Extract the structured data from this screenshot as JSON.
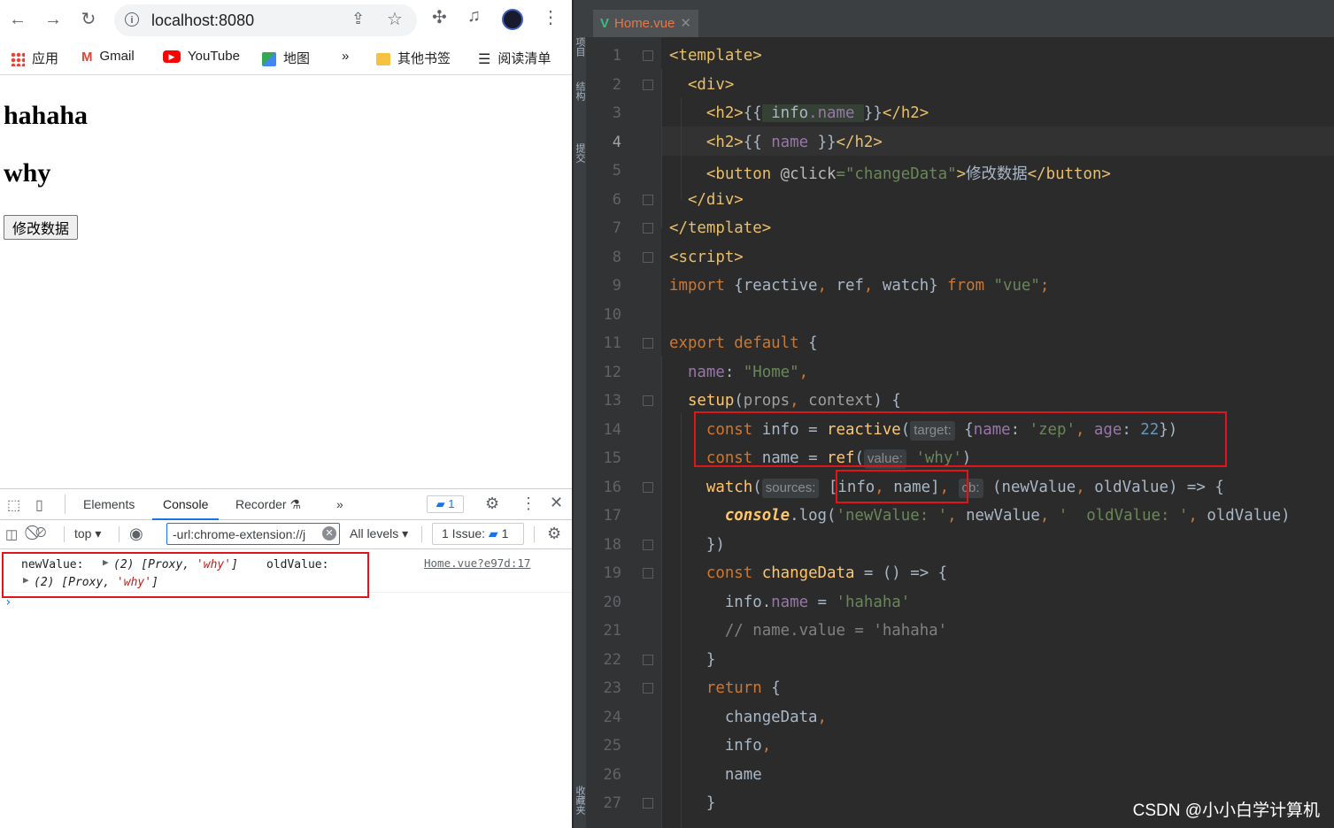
{
  "browser": {
    "url": "localhost:8080",
    "bookmarks": [
      "应用",
      "Gmail",
      "YouTube",
      "地图",
      "»",
      "其他书签",
      "阅读清单"
    ]
  },
  "page": {
    "h2_1": "hahaha",
    "h2_2": "why",
    "button_label": "修改数据"
  },
  "devtools": {
    "tabs": [
      "Elements",
      "Console",
      "Recorder",
      "»"
    ],
    "active_tab": "Console",
    "issues_badge": "1",
    "context": "top",
    "filter_value": "-url:chrome-extension://j",
    "levels": "All levels",
    "issues_label": "1 Issue:",
    "issues_count": "1",
    "log": {
      "label_new": "newValue:",
      "new_value": "(2) [Proxy, ",
      "new_str": "'why'",
      "close": "]",
      "label_old": "oldValue:",
      "old_value": "(2) [Proxy, ",
      "old_str": "'why'",
      "source": "Home.vue?e97d:17"
    },
    "prompt": "›"
  },
  "editor": {
    "tab_label": "Home.vue",
    "side_labels": [
      "项目",
      "结构",
      "提交",
      "收藏夹"
    ],
    "line_numbers": [
      "1",
      "2",
      "3",
      "4",
      "5",
      "6",
      "7",
      "8",
      "9",
      "10",
      "11",
      "12",
      "13",
      "14",
      "15",
      "16",
      "17",
      "18",
      "19",
      "20",
      "21",
      "22",
      "23",
      "24",
      "25",
      "26",
      "27"
    ],
    "current_line": "4"
  },
  "watermark": "CSDN @小小白学计算机"
}
